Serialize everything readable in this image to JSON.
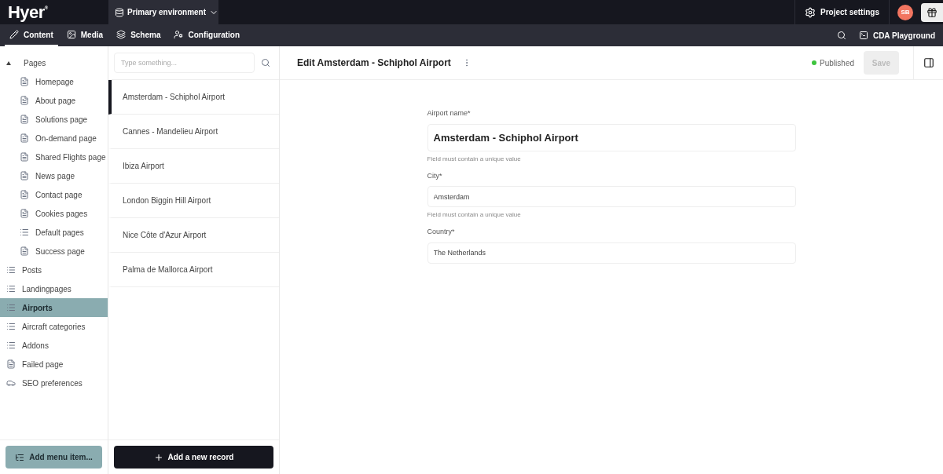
{
  "topbar": {
    "logo": "Hyer",
    "logo_mark": "®",
    "environment": "Primary environment",
    "project_settings": "Project settings",
    "avatar": "SB"
  },
  "nav": {
    "tabs": [
      {
        "label": "Content",
        "selected": true
      },
      {
        "label": "Media",
        "selected": false
      },
      {
        "label": "Schema",
        "selected": false
      },
      {
        "label": "Configuration",
        "selected": false
      }
    ],
    "playground": "CDA Playground"
  },
  "sidebar": {
    "items": [
      {
        "label": "Pages",
        "kind": "folder",
        "expanded": true,
        "selected": false,
        "children": [
          {
            "label": "Homepage",
            "kind": "page",
            "selected": false
          },
          {
            "label": "About page",
            "kind": "page",
            "selected": false
          },
          {
            "label": "Solutions page",
            "kind": "page",
            "selected": false
          },
          {
            "label": "On-demand page",
            "kind": "page",
            "selected": false
          },
          {
            "label": "Shared Flights page",
            "kind": "page",
            "selected": false
          },
          {
            "label": "News page",
            "kind": "page",
            "selected": false
          },
          {
            "label": "Contact page",
            "kind": "page",
            "selected": false
          },
          {
            "label": "Cookies pages",
            "kind": "page",
            "selected": false
          },
          {
            "label": "Default pages",
            "kind": "list",
            "selected": false
          },
          {
            "label": "Success page",
            "kind": "page",
            "selected": false
          }
        ]
      },
      {
        "label": "Posts",
        "kind": "list",
        "selected": false
      },
      {
        "label": "Landingpages",
        "kind": "list",
        "selected": false
      },
      {
        "label": "Airports",
        "kind": "list",
        "selected": true
      },
      {
        "label": "Aircraft categories",
        "kind": "list",
        "selected": false
      },
      {
        "label": "Addons",
        "kind": "list",
        "selected": false
      },
      {
        "label": "Failed page",
        "kind": "page",
        "selected": false
      },
      {
        "label": "SEO preferences",
        "kind": "seo",
        "selected": false
      }
    ],
    "add_button": "Add menu item..."
  },
  "records": {
    "search": {
      "placeholder": "Type something..."
    },
    "items": [
      {
        "label": "Amsterdam - Schiphol Airport",
        "selected": true
      },
      {
        "label": "Cannes - Mandelieu Airport",
        "selected": false
      },
      {
        "label": "Ibiza Airport",
        "selected": false
      },
      {
        "label": "London Biggin Hill Airport",
        "selected": false
      },
      {
        "label": "Nice Côte d'Azur Airport",
        "selected": false
      },
      {
        "label": "Palma de Mallorca Airport",
        "selected": false
      }
    ],
    "add_button": "Add a new record"
  },
  "editor": {
    "title": "Edit Amsterdam - Schiphol Airport",
    "status": "Published",
    "save": "Save",
    "save_disabled": true,
    "fields": [
      {
        "label": "Airport name*",
        "value": "Amsterdam - Schiphol Airport",
        "kind": "title",
        "hint": "Field must contain a unique value"
      },
      {
        "label": "City*",
        "value": "Amsterdam",
        "kind": "text",
        "hint": "Field must contain a unique value"
      },
      {
        "label": "Country*",
        "value": "The Netherlands",
        "kind": "text"
      }
    ]
  }
}
